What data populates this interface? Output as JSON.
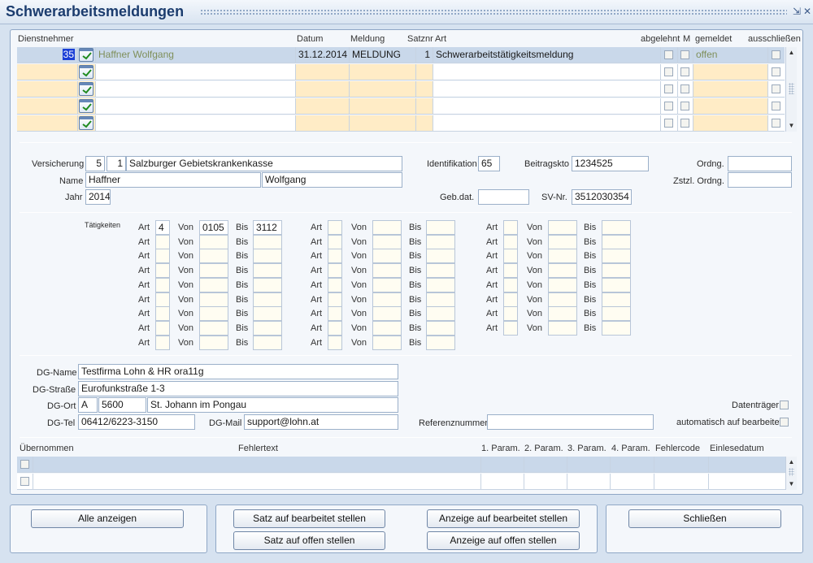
{
  "window": {
    "title": "Schwerarbeitsmeldungen",
    "minimize": "⇲",
    "close": "✕"
  },
  "grid": {
    "headers": {
      "dienstnehmer": "Dienstnehmer",
      "datum": "Datum",
      "meldung": "Meldung",
      "satznr": "Satznr",
      "art": "Art",
      "abgelehnt": "abgelehnt",
      "m": "M",
      "gemeldet": "gemeldet",
      "ausschliessen": "ausschließen"
    },
    "rows": [
      {
        "nr": "35",
        "name": "Haffner Wolfgang",
        "datum": "31.12.2014",
        "meldung": "MELDUNG",
        "satznr": "1",
        "art": "Schwerarbeitstätigkeitsmeldung",
        "gemeldet": "offen"
      },
      {
        "nr": "",
        "name": "",
        "datum": "",
        "meldung": "",
        "satznr": "",
        "art": "",
        "gemeldet": ""
      },
      {
        "nr": "",
        "name": "",
        "datum": "",
        "meldung": "",
        "satznr": "",
        "art": "",
        "gemeldet": ""
      },
      {
        "nr": "",
        "name": "",
        "datum": "",
        "meldung": "",
        "satznr": "",
        "art": "",
        "gemeldet": ""
      },
      {
        "nr": "",
        "name": "",
        "datum": "",
        "meldung": "",
        "satznr": "",
        "art": "",
        "gemeldet": ""
      }
    ]
  },
  "person": {
    "versicherung_label": "Versicherung",
    "versicherung_a": "5",
    "versicherung_b": "1",
    "versicherung_name": "Salzburger Gebietskrankenkasse",
    "name_label": "Name",
    "nachname": "Haffner",
    "vorname": "Wolfgang",
    "jahr_label": "Jahr",
    "jahr": "2014",
    "identifikation_label": "Identifikation",
    "identifikation": "65",
    "beitragskto_label": "Beitragskto",
    "beitragskto": "1234525",
    "gebdat_label": "Geb.dat.",
    "gebdat": "",
    "svnr_label": "SV-Nr.",
    "svnr": "3512030354",
    "ordng_label": "Ordng.",
    "ordng": "",
    "zstzl_label": "Zstzl. Ordng.",
    "zstzl": ""
  },
  "taetigkeiten": {
    "label": "Tätigkeiten",
    "art_label": "Art",
    "von_label": "Von",
    "bis_label": "Bis",
    "col1": [
      {
        "art": "4",
        "von": "0105",
        "bis": "3112"
      },
      {
        "art": "",
        "von": "",
        "bis": ""
      },
      {
        "art": "",
        "von": "",
        "bis": ""
      },
      {
        "art": "",
        "von": "",
        "bis": ""
      },
      {
        "art": "",
        "von": "",
        "bis": ""
      },
      {
        "art": "",
        "von": "",
        "bis": ""
      },
      {
        "art": "",
        "von": "",
        "bis": ""
      },
      {
        "art": "",
        "von": "",
        "bis": ""
      },
      {
        "art": "",
        "von": "",
        "bis": ""
      }
    ]
  },
  "dienstgeber": {
    "name_label": "DG-Name",
    "name": "Testfirma Lohn & HR ora11g",
    "strasse_label": "DG-Straße",
    "strasse": "Eurofunkstraße 1-3",
    "ort_label": "DG-Ort",
    "land": "A",
    "plz": "5600",
    "ort": "St. Johann im Pongau",
    "tel_label": "DG-Tel",
    "tel": "06412/6223-3150",
    "mail_label": "DG-Mail",
    "mail": "support@lohn.at",
    "referenz_label": "Referenznummer",
    "referenz": "",
    "datentraeger_label": "Datenträger",
    "auto_label": "automatisch auf bearbeitet"
  },
  "fehler": {
    "headers": {
      "uebernommen": "Übernommen",
      "fehlertext": "Fehlertext",
      "p1": "1. Param.",
      "p2": "2. Param.",
      "p3": "3. Param.",
      "p4": "4. Param.",
      "code": "Fehlercode",
      "datum": "Einlesedatum"
    }
  },
  "buttons": {
    "alle_anzeigen": "Alle anzeigen",
    "satz_bearbeitet": "Satz auf bearbeitet stellen",
    "satz_offen": "Satz auf offen stellen",
    "anzeige_bearbeitet": "Anzeige auf bearbeitet stellen",
    "anzeige_offen": "Anzeige auf offen stellen",
    "schliessen": "Schließen"
  },
  "colors": {
    "title": "#1b3c6e",
    "highlight": "#1a3fd6",
    "rowYellow": "#ffecc6"
  },
  "icons": {
    "row_check": "check-document-icon",
    "scroll_up": "arrow-up-icon",
    "scroll_down": "arrow-down-icon"
  }
}
